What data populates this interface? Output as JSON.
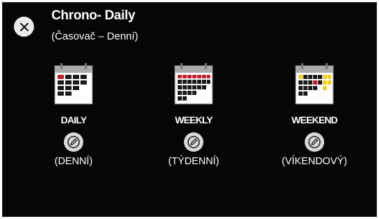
{
  "dialog": {
    "title": "Chrono- Daily",
    "subtitle": "(Časovač – Denní)",
    "close_icon": "close-icon"
  },
  "options": [
    {
      "label": "DAILY",
      "sublabel": "(DENNÍ)",
      "icon": "calendar-daily-icon",
      "edit_icon": "pencil-icon"
    },
    {
      "label": "WEEKLY",
      "sublabel": "(TÝDENNÍ)",
      "icon": "calendar-weekly-icon",
      "edit_icon": "pencil-icon"
    },
    {
      "label": "WEEKEND",
      "sublabel": "(VÍKENDOVÝ)",
      "icon": "calendar-weekend-icon",
      "edit_icon": "pencil-icon"
    }
  ],
  "colors": {
    "background": "#060606",
    "text": "#ffffff",
    "calendar_header": "#aaaaaa",
    "calendar_red": "#c41e2a",
    "calendar_yellow": "#f2cf1a"
  }
}
